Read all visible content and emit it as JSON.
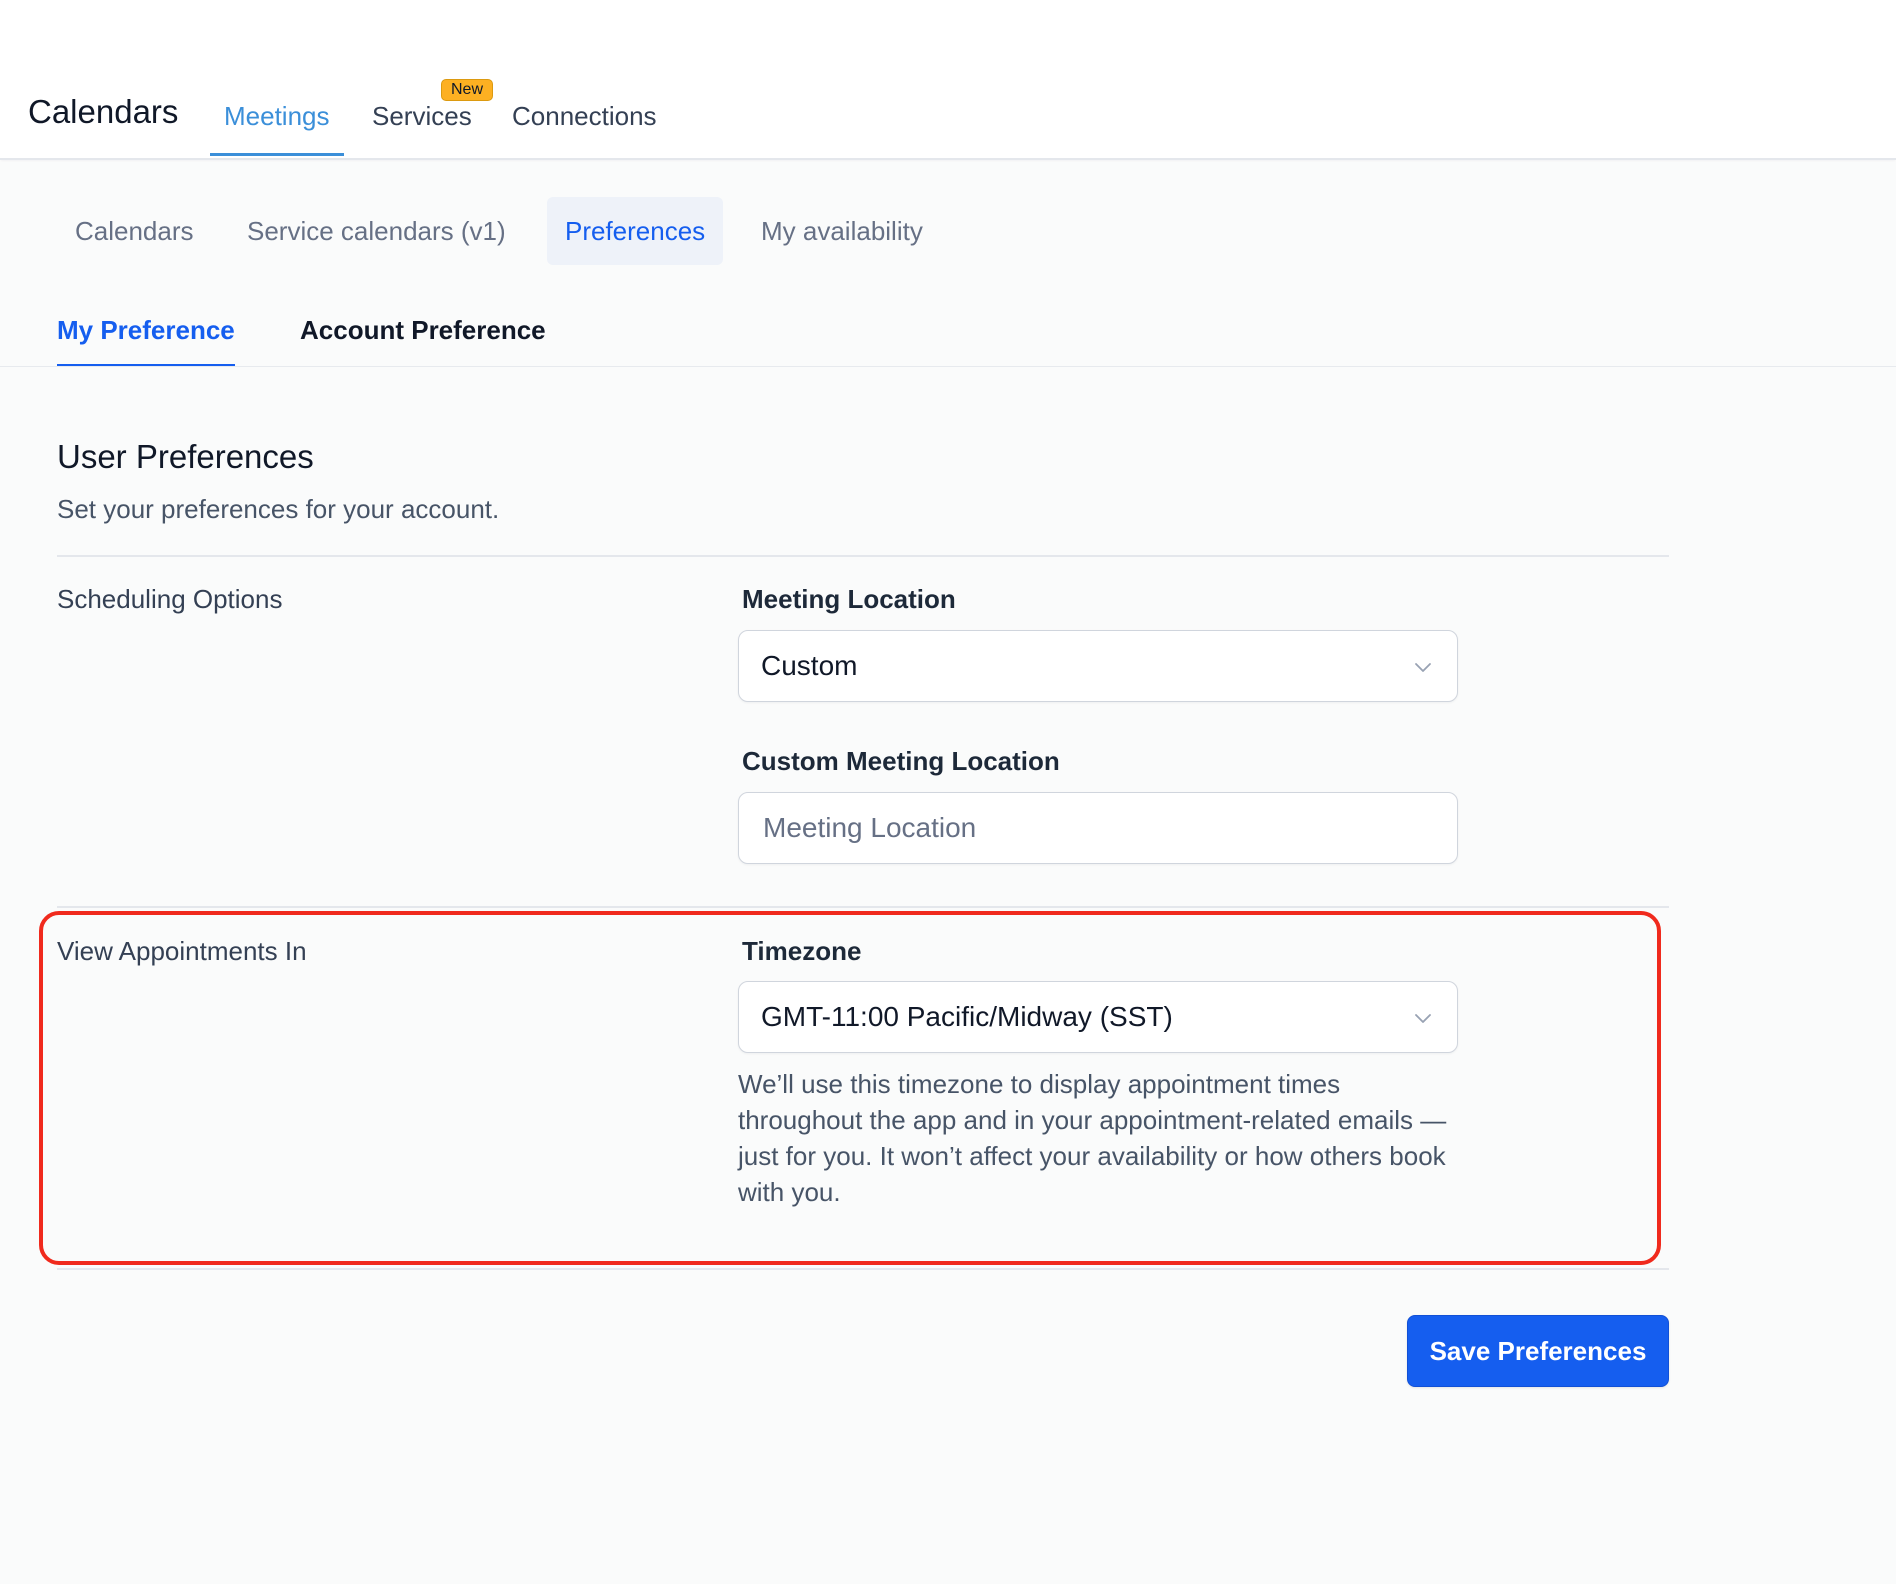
{
  "header": {
    "app_title": "Calendars",
    "tabs": [
      {
        "label": "Meetings",
        "active": true
      },
      {
        "label": "Services",
        "badge": "New"
      },
      {
        "label": "Connections"
      }
    ]
  },
  "sub_tabs": [
    {
      "label": "Calendars"
    },
    {
      "label": "Service calendars (v1)"
    },
    {
      "label": "Preferences",
      "active": true
    },
    {
      "label": "My availability"
    }
  ],
  "preference_tabs": [
    {
      "label": "My Preference",
      "active": true
    },
    {
      "label": "Account Preference"
    }
  ],
  "section": {
    "title": "User Preferences",
    "subtitle": "Set your preferences for your account."
  },
  "scheduling": {
    "row_label": "Scheduling Options",
    "meeting_location_label": "Meeting Location",
    "meeting_location_value": "Custom",
    "custom_location_label": "Custom Meeting Location",
    "custom_location_placeholder": "Meeting Location",
    "custom_location_value": ""
  },
  "view_appointments": {
    "row_label": "View Appointments In",
    "timezone_label": "Timezone",
    "timezone_value": "GMT-11:00 Pacific/Midway (SST)",
    "help_text": "We’ll use this timezone to display appointment times throughout the app and in your appointment-related emails — just for you. It won’t affect your availability or how others book with you."
  },
  "actions": {
    "save_label": "Save Preferences"
  },
  "colors": {
    "accent": "#155eef",
    "top_tab_active": "#3b8fd9",
    "badge": "#fdb022",
    "highlight": "#f02a1d"
  },
  "icons": {
    "select_arrow": "chevron-down-icon"
  }
}
